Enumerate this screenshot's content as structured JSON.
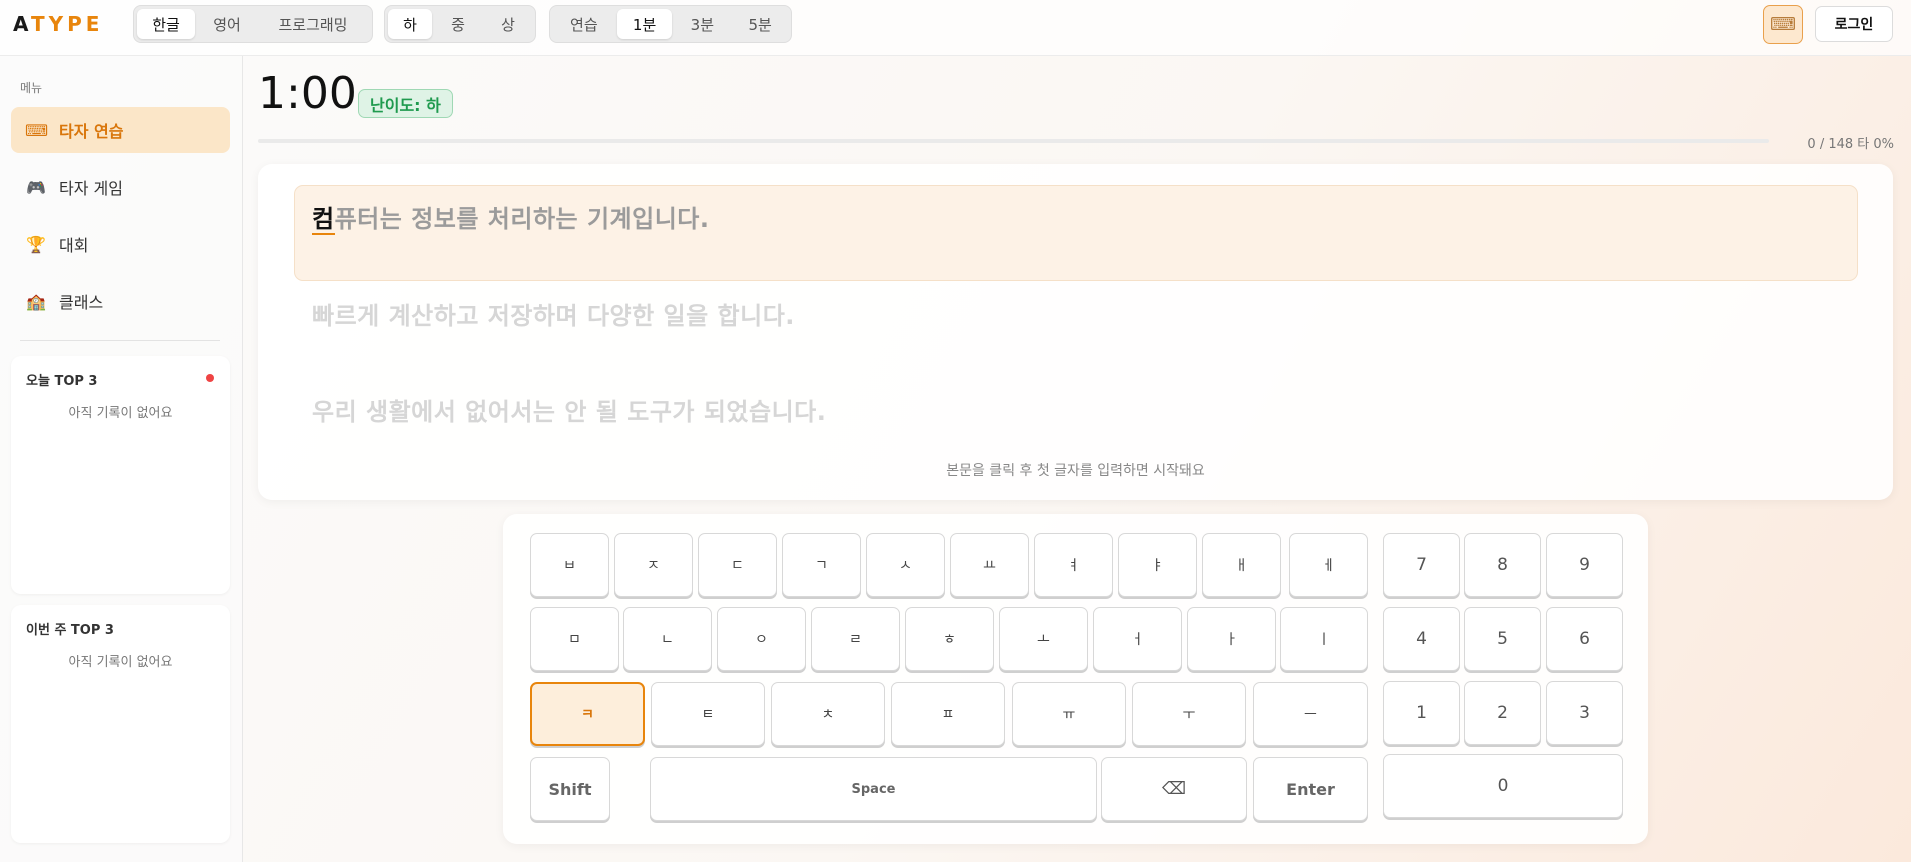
{
  "header": {
    "logo_first": "A",
    "logo_rest": "TYPE",
    "language_options": [
      "한글",
      "영어",
      "프로그래밍"
    ],
    "language_selected": "한글",
    "difficulty_options": [
      "하",
      "중",
      "상"
    ],
    "difficulty_selected": "하",
    "duration_options": [
      "연습",
      "1분",
      "3분",
      "5분"
    ],
    "duration_selected": "1분",
    "keyboard_toggle_icon": "keyboard-icon",
    "login_label": "로그인"
  },
  "sidebar": {
    "menu_title": "메뉴",
    "items": [
      {
        "label": "타자 연습",
        "icon": "keyboard-icon",
        "glyph": "⌨",
        "active": true
      },
      {
        "label": "타자 게임",
        "icon": "gamepad-icon",
        "glyph": "🎮",
        "active": false
      },
      {
        "label": "대회",
        "icon": "trophy-icon",
        "glyph": "🏆",
        "active": false
      },
      {
        "label": "클래스",
        "icon": "school-icon",
        "glyph": "🏫",
        "active": false
      }
    ],
    "today_top3": {
      "title": "오늘 TOP 3",
      "empty": "아직 기록이 없어요"
    },
    "week_top3": {
      "title": "이번 주 TOP 3",
      "empty": "아직 기록이 없어요"
    }
  },
  "main": {
    "timer": "1:00",
    "level_badge": "난이도: 하",
    "progress": 0,
    "stat_text": "0 / 148 타 0%",
    "lines": {
      "line1_current": "컴",
      "line1_rest": "퓨터는 정보를 처리하는 기계입니다.",
      "line2": "빠르게 계산하고 저장하며 다양한 일을 합니다.",
      "line3": "우리 생활에서 없어서는 안 될 도구가 되었습니다."
    },
    "hint": "본문을 클릭 후 첫 글자를 입력하면 시작돼요"
  },
  "keyboard": {
    "row1": [
      "ㅂ",
      "ㅈ",
      "ㄷ",
      "ㄱ",
      "ㅅ",
      "ㅛ",
      "ㅕ",
      "ㅑ",
      "ㅐ",
      "ㅔ"
    ],
    "row2": [
      "ㅁ",
      "ㄴ",
      "ㅇ",
      "ㄹ",
      "ㅎ",
      "ㅗ",
      "ㅓ",
      "ㅏ",
      "ㅣ"
    ],
    "row3": [
      "ㅋ",
      "ㅌ",
      "ㅊ",
      "ㅍ",
      "ㅠ",
      "ㅜ",
      "ㅡ"
    ],
    "highlighted_key": "ㅋ",
    "shift_label": "Shift",
    "space_label": "Space",
    "backspace_label": "⌫",
    "enter_label": "Enter",
    "numpad": [
      "7",
      "8",
      "9",
      "4",
      "5",
      "6",
      "1",
      "2",
      "3",
      "0"
    ]
  }
}
